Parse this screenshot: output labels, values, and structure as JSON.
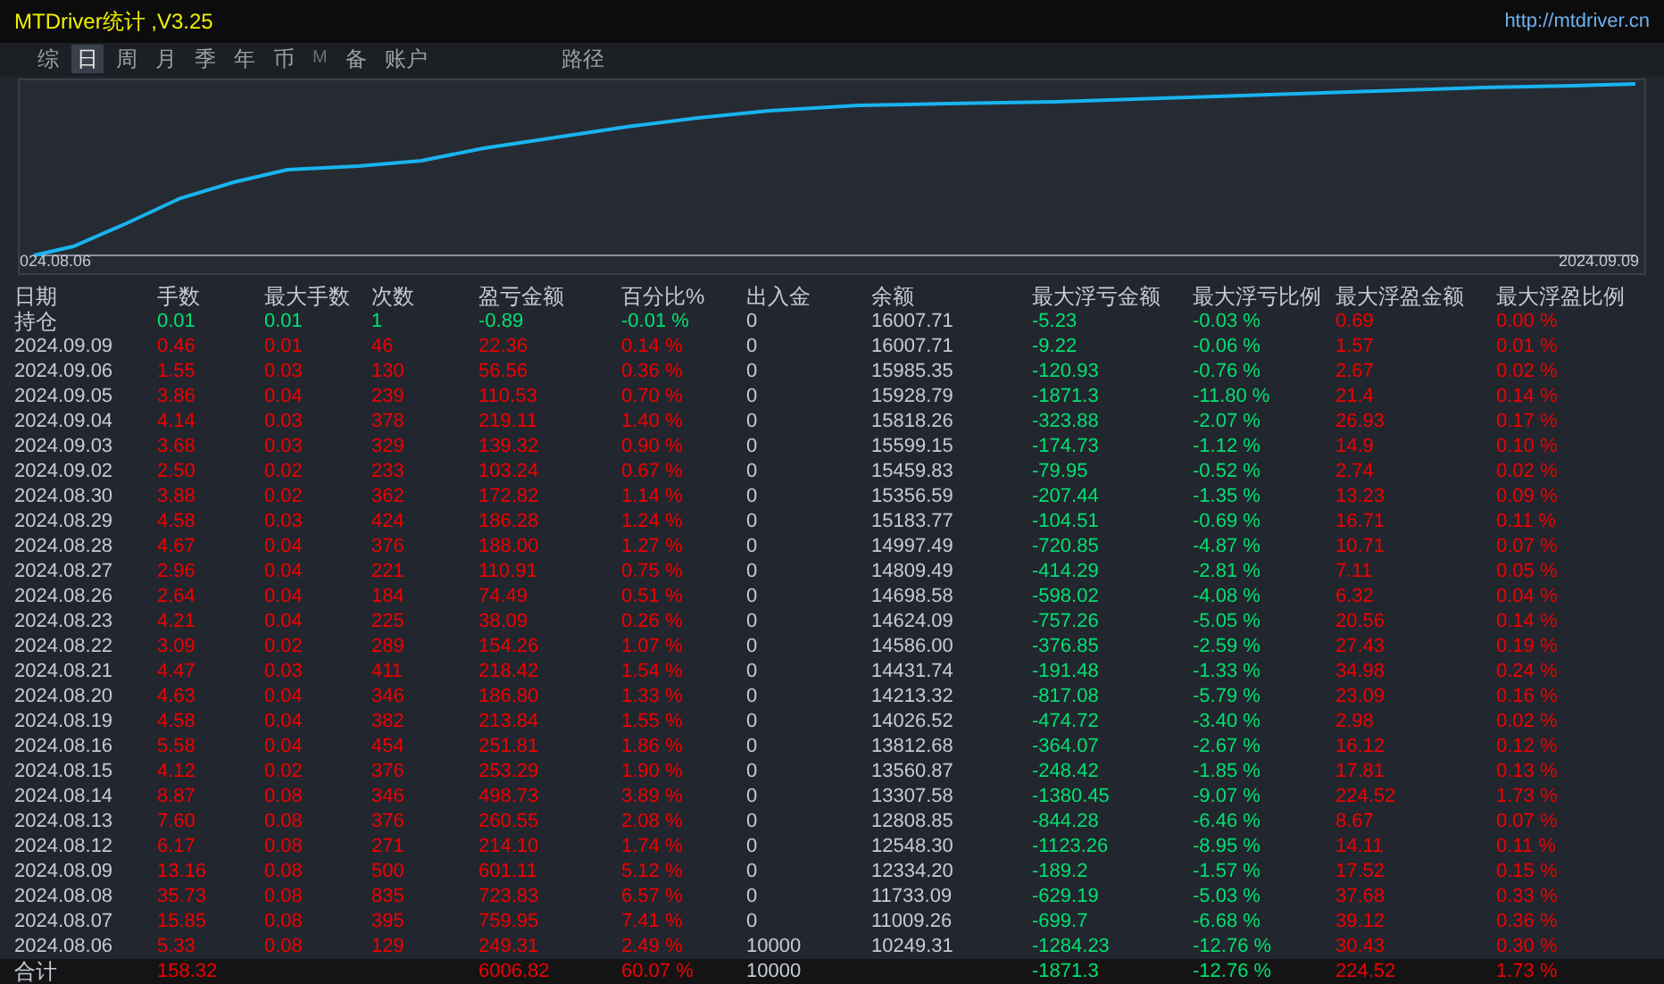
{
  "window": {
    "title": "MTDriver统计 ,V3.25",
    "link": "http://mtdriver.cn"
  },
  "tabs": [
    {
      "label": "综",
      "selected": false,
      "dim": false
    },
    {
      "label": "日",
      "selected": true,
      "dim": false
    },
    {
      "label": "周",
      "selected": false,
      "dim": false
    },
    {
      "label": "月",
      "selected": false,
      "dim": false
    },
    {
      "label": "季",
      "selected": false,
      "dim": false
    },
    {
      "label": "年",
      "selected": false,
      "dim": false
    },
    {
      "label": "币",
      "selected": false,
      "dim": false
    },
    {
      "label": "M",
      "selected": false,
      "dim": true
    },
    {
      "label": "备",
      "selected": false,
      "dim": false
    },
    {
      "label": "账户",
      "selected": false,
      "dim": false
    }
  ],
  "path_label": "路径",
  "chart": {
    "start_label": "024.08.06",
    "end_label": "2024.09.09"
  },
  "table": {
    "columns": [
      "日期",
      "手数",
      "最大手数",
      "次数",
      "盈亏金额",
      "百分比%",
      "出入金",
      "余额",
      "最大浮亏金额",
      "最大浮亏比例",
      "最大浮盈金额",
      "最大浮盈比例"
    ],
    "rows": [
      {
        "kind": "open",
        "cells": [
          "持仓",
          "0.01",
          "0.01",
          "1",
          "-0.89",
          "-0.01 %",
          "0",
          "16007.71",
          "-5.23",
          "-0.03 %",
          "0.69",
          "0.00 %"
        ]
      },
      {
        "kind": "day",
        "cells": [
          "2024.09.09",
          "0.46",
          "0.01",
          "46",
          "22.36",
          "0.14 %",
          "0",
          "16007.71",
          "-9.22",
          "-0.06 %",
          "1.57",
          "0.01 %"
        ]
      },
      {
        "kind": "day",
        "cells": [
          "2024.09.06",
          "1.55",
          "0.03",
          "130",
          "56.56",
          "0.36 %",
          "0",
          "15985.35",
          "-120.93",
          "-0.76 %",
          "2.67",
          "0.02 %"
        ]
      },
      {
        "kind": "day",
        "cells": [
          "2024.09.05",
          "3.86",
          "0.04",
          "239",
          "110.53",
          "0.70 %",
          "0",
          "15928.79",
          "-1871.3",
          "-11.80 %",
          "21.4",
          "0.14 %"
        ]
      },
      {
        "kind": "day",
        "cells": [
          "2024.09.04",
          "4.14",
          "0.03",
          "378",
          "219.11",
          "1.40 %",
          "0",
          "15818.26",
          "-323.88",
          "-2.07 %",
          "26.93",
          "0.17 %"
        ]
      },
      {
        "kind": "day",
        "cells": [
          "2024.09.03",
          "3.68",
          "0.03",
          "329",
          "139.32",
          "0.90 %",
          "0",
          "15599.15",
          "-174.73",
          "-1.12 %",
          "14.9",
          "0.10 %"
        ]
      },
      {
        "kind": "day",
        "cells": [
          "2024.09.02",
          "2.50",
          "0.02",
          "233",
          "103.24",
          "0.67 %",
          "0",
          "15459.83",
          "-79.95",
          "-0.52 %",
          "2.74",
          "0.02 %"
        ]
      },
      {
        "kind": "day",
        "cells": [
          "2024.08.30",
          "3.88",
          "0.02",
          "362",
          "172.82",
          "1.14 %",
          "0",
          "15356.59",
          "-207.44",
          "-1.35 %",
          "13.23",
          "0.09 %"
        ]
      },
      {
        "kind": "day",
        "cells": [
          "2024.08.29",
          "4.58",
          "0.03",
          "424",
          "186.28",
          "1.24 %",
          "0",
          "15183.77",
          "-104.51",
          "-0.69 %",
          "16.71",
          "0.11 %"
        ]
      },
      {
        "kind": "day",
        "cells": [
          "2024.08.28",
          "4.67",
          "0.04",
          "376",
          "188.00",
          "1.27 %",
          "0",
          "14997.49",
          "-720.85",
          "-4.87 %",
          "10.71",
          "0.07 %"
        ]
      },
      {
        "kind": "day",
        "cells": [
          "2024.08.27",
          "2.96",
          "0.04",
          "221",
          "110.91",
          "0.75 %",
          "0",
          "14809.49",
          "-414.29",
          "-2.81 %",
          "7.11",
          "0.05 %"
        ]
      },
      {
        "kind": "day",
        "cells": [
          "2024.08.26",
          "2.64",
          "0.04",
          "184",
          "74.49",
          "0.51 %",
          "0",
          "14698.58",
          "-598.02",
          "-4.08 %",
          "6.32",
          "0.04 %"
        ]
      },
      {
        "kind": "day",
        "cells": [
          "2024.08.23",
          "4.21",
          "0.04",
          "225",
          "38.09",
          "0.26 %",
          "0",
          "14624.09",
          "-757.26",
          "-5.05 %",
          "20.56",
          "0.14 %"
        ]
      },
      {
        "kind": "day",
        "cells": [
          "2024.08.22",
          "3.09",
          "0.02",
          "289",
          "154.26",
          "1.07 %",
          "0",
          "14586.00",
          "-376.85",
          "-2.59 %",
          "27.43",
          "0.19 %"
        ]
      },
      {
        "kind": "day",
        "cells": [
          "2024.08.21",
          "4.47",
          "0.03",
          "411",
          "218.42",
          "1.54 %",
          "0",
          "14431.74",
          "-191.48",
          "-1.33 %",
          "34.98",
          "0.24 %"
        ]
      },
      {
        "kind": "day",
        "cells": [
          "2024.08.20",
          "4.63",
          "0.04",
          "346",
          "186.80",
          "1.33 %",
          "0",
          "14213.32",
          "-817.08",
          "-5.79 %",
          "23.09",
          "0.16 %"
        ]
      },
      {
        "kind": "day",
        "cells": [
          "2024.08.19",
          "4.58",
          "0.04",
          "382",
          "213.84",
          "1.55 %",
          "0",
          "14026.52",
          "-474.72",
          "-3.40 %",
          "2.98",
          "0.02 %"
        ]
      },
      {
        "kind": "day",
        "cells": [
          "2024.08.16",
          "5.58",
          "0.04",
          "454",
          "251.81",
          "1.86 %",
          "0",
          "13812.68",
          "-364.07",
          "-2.67 %",
          "16.12",
          "0.12 %"
        ]
      },
      {
        "kind": "day",
        "cells": [
          "2024.08.15",
          "4.12",
          "0.02",
          "376",
          "253.29",
          "1.90 %",
          "0",
          "13560.87",
          "-248.42",
          "-1.85 %",
          "17.81",
          "0.13 %"
        ]
      },
      {
        "kind": "day",
        "cells": [
          "2024.08.14",
          "8.87",
          "0.08",
          "346",
          "498.73",
          "3.89 %",
          "0",
          "13307.58",
          "-1380.45",
          "-9.07 %",
          "224.52",
          "1.73 %"
        ]
      },
      {
        "kind": "day",
        "cells": [
          "2024.08.13",
          "7.60",
          "0.08",
          "376",
          "260.55",
          "2.08 %",
          "0",
          "12808.85",
          "-844.28",
          "-6.46 %",
          "8.67",
          "0.07 %"
        ]
      },
      {
        "kind": "day",
        "cells": [
          "2024.08.12",
          "6.17",
          "0.08",
          "271",
          "214.10",
          "1.74 %",
          "0",
          "12548.30",
          "-1123.26",
          "-8.95 %",
          "14.11",
          "0.11 %"
        ]
      },
      {
        "kind": "day",
        "cells": [
          "2024.08.09",
          "13.16",
          "0.08",
          "500",
          "601.11",
          "5.12 %",
          "0",
          "12334.20",
          "-189.2",
          "-1.57 %",
          "17.52",
          "0.15 %"
        ]
      },
      {
        "kind": "day",
        "cells": [
          "2024.08.08",
          "35.73",
          "0.08",
          "835",
          "723.83",
          "6.57 %",
          "0",
          "11733.09",
          "-629.19",
          "-5.03 %",
          "37.68",
          "0.33 %"
        ]
      },
      {
        "kind": "day",
        "cells": [
          "2024.08.07",
          "15.85",
          "0.08",
          "395",
          "759.95",
          "7.41 %",
          "0",
          "11009.26",
          "-699.7",
          "-6.68 %",
          "39.12",
          "0.36 %"
        ]
      },
      {
        "kind": "day",
        "cells": [
          "2024.08.06",
          "5.33",
          "0.08",
          "129",
          "249.31",
          "2.49 %",
          "10000",
          "10249.31",
          "-1284.23",
          "-12.76 %",
          "30.43",
          "0.30 %"
        ]
      },
      {
        "kind": "total",
        "cells": [
          "合计",
          "158.32",
          null,
          null,
          "6006.82",
          "60.07 %",
          "10000",
          null,
          "-1871.3",
          "-12.76 %",
          "224.52",
          "1.73 %"
        ]
      }
    ]
  }
}
